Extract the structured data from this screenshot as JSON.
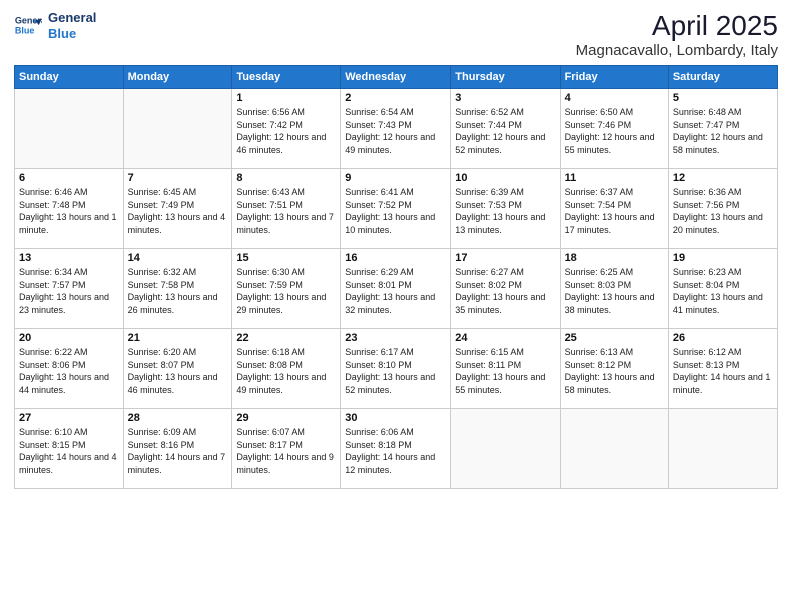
{
  "header": {
    "logo_line1": "General",
    "logo_line2": "Blue",
    "title": "April 2025",
    "subtitle": "Magnacavallo, Lombardy, Italy"
  },
  "days_of_week": [
    "Sunday",
    "Monday",
    "Tuesday",
    "Wednesday",
    "Thursday",
    "Friday",
    "Saturday"
  ],
  "weeks": [
    [
      {
        "day": "",
        "info": ""
      },
      {
        "day": "",
        "info": ""
      },
      {
        "day": "1",
        "info": "Sunrise: 6:56 AM\nSunset: 7:42 PM\nDaylight: 12 hours and 46 minutes."
      },
      {
        "day": "2",
        "info": "Sunrise: 6:54 AM\nSunset: 7:43 PM\nDaylight: 12 hours and 49 minutes."
      },
      {
        "day": "3",
        "info": "Sunrise: 6:52 AM\nSunset: 7:44 PM\nDaylight: 12 hours and 52 minutes."
      },
      {
        "day": "4",
        "info": "Sunrise: 6:50 AM\nSunset: 7:46 PM\nDaylight: 12 hours and 55 minutes."
      },
      {
        "day": "5",
        "info": "Sunrise: 6:48 AM\nSunset: 7:47 PM\nDaylight: 12 hours and 58 minutes."
      }
    ],
    [
      {
        "day": "6",
        "info": "Sunrise: 6:46 AM\nSunset: 7:48 PM\nDaylight: 13 hours and 1 minute."
      },
      {
        "day": "7",
        "info": "Sunrise: 6:45 AM\nSunset: 7:49 PM\nDaylight: 13 hours and 4 minutes."
      },
      {
        "day": "8",
        "info": "Sunrise: 6:43 AM\nSunset: 7:51 PM\nDaylight: 13 hours and 7 minutes."
      },
      {
        "day": "9",
        "info": "Sunrise: 6:41 AM\nSunset: 7:52 PM\nDaylight: 13 hours and 10 minutes."
      },
      {
        "day": "10",
        "info": "Sunrise: 6:39 AM\nSunset: 7:53 PM\nDaylight: 13 hours and 13 minutes."
      },
      {
        "day": "11",
        "info": "Sunrise: 6:37 AM\nSunset: 7:54 PM\nDaylight: 13 hours and 17 minutes."
      },
      {
        "day": "12",
        "info": "Sunrise: 6:36 AM\nSunset: 7:56 PM\nDaylight: 13 hours and 20 minutes."
      }
    ],
    [
      {
        "day": "13",
        "info": "Sunrise: 6:34 AM\nSunset: 7:57 PM\nDaylight: 13 hours and 23 minutes."
      },
      {
        "day": "14",
        "info": "Sunrise: 6:32 AM\nSunset: 7:58 PM\nDaylight: 13 hours and 26 minutes."
      },
      {
        "day": "15",
        "info": "Sunrise: 6:30 AM\nSunset: 7:59 PM\nDaylight: 13 hours and 29 minutes."
      },
      {
        "day": "16",
        "info": "Sunrise: 6:29 AM\nSunset: 8:01 PM\nDaylight: 13 hours and 32 minutes."
      },
      {
        "day": "17",
        "info": "Sunrise: 6:27 AM\nSunset: 8:02 PM\nDaylight: 13 hours and 35 minutes."
      },
      {
        "day": "18",
        "info": "Sunrise: 6:25 AM\nSunset: 8:03 PM\nDaylight: 13 hours and 38 minutes."
      },
      {
        "day": "19",
        "info": "Sunrise: 6:23 AM\nSunset: 8:04 PM\nDaylight: 13 hours and 41 minutes."
      }
    ],
    [
      {
        "day": "20",
        "info": "Sunrise: 6:22 AM\nSunset: 8:06 PM\nDaylight: 13 hours and 44 minutes."
      },
      {
        "day": "21",
        "info": "Sunrise: 6:20 AM\nSunset: 8:07 PM\nDaylight: 13 hours and 46 minutes."
      },
      {
        "day": "22",
        "info": "Sunrise: 6:18 AM\nSunset: 8:08 PM\nDaylight: 13 hours and 49 minutes."
      },
      {
        "day": "23",
        "info": "Sunrise: 6:17 AM\nSunset: 8:10 PM\nDaylight: 13 hours and 52 minutes."
      },
      {
        "day": "24",
        "info": "Sunrise: 6:15 AM\nSunset: 8:11 PM\nDaylight: 13 hours and 55 minutes."
      },
      {
        "day": "25",
        "info": "Sunrise: 6:13 AM\nSunset: 8:12 PM\nDaylight: 13 hours and 58 minutes."
      },
      {
        "day": "26",
        "info": "Sunrise: 6:12 AM\nSunset: 8:13 PM\nDaylight: 14 hours and 1 minute."
      }
    ],
    [
      {
        "day": "27",
        "info": "Sunrise: 6:10 AM\nSunset: 8:15 PM\nDaylight: 14 hours and 4 minutes."
      },
      {
        "day": "28",
        "info": "Sunrise: 6:09 AM\nSunset: 8:16 PM\nDaylight: 14 hours and 7 minutes."
      },
      {
        "day": "29",
        "info": "Sunrise: 6:07 AM\nSunset: 8:17 PM\nDaylight: 14 hours and 9 minutes."
      },
      {
        "day": "30",
        "info": "Sunrise: 6:06 AM\nSunset: 8:18 PM\nDaylight: 14 hours and 12 minutes."
      },
      {
        "day": "",
        "info": ""
      },
      {
        "day": "",
        "info": ""
      },
      {
        "day": "",
        "info": ""
      }
    ]
  ]
}
